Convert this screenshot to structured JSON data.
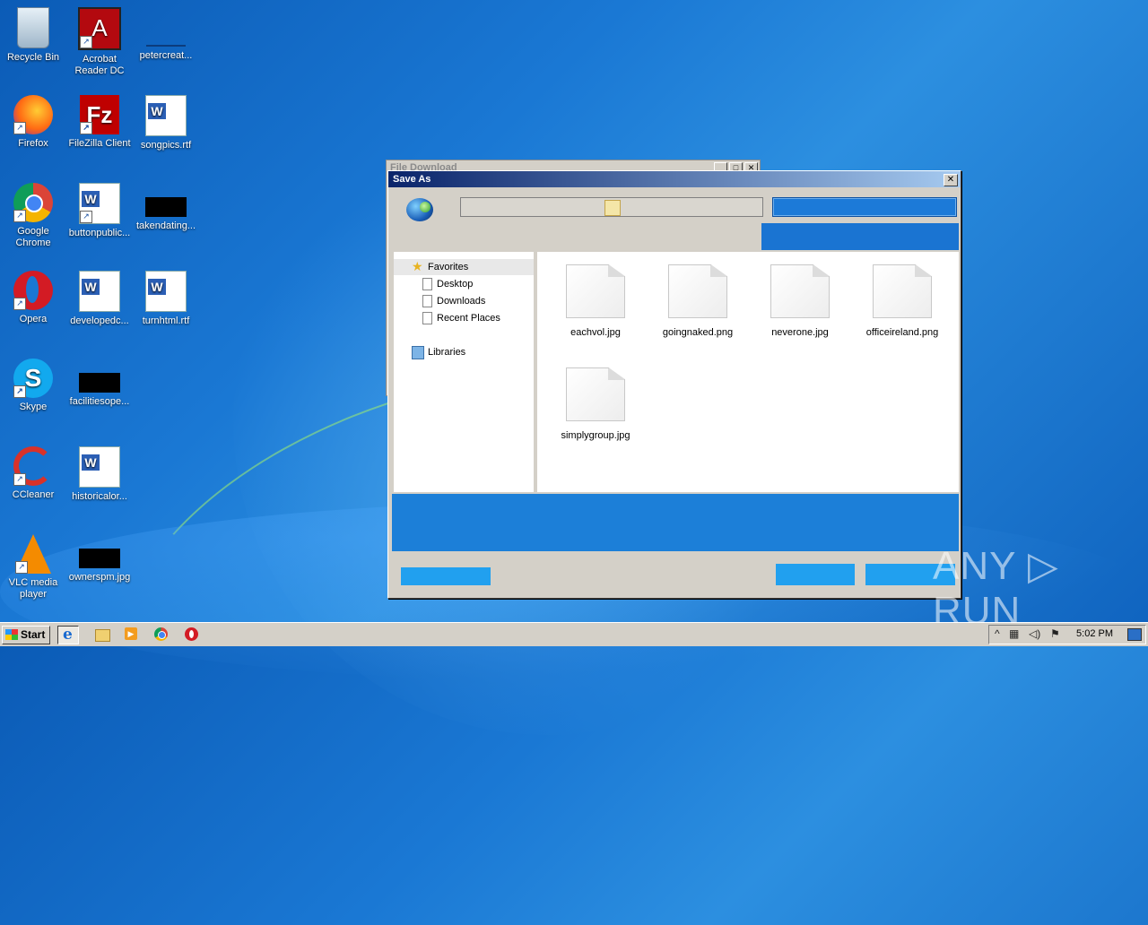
{
  "desktop": {
    "icons": [
      {
        "name": "Recycle Bin"
      },
      {
        "name": "Acrobat Reader DC"
      },
      {
        "name": "petercreat..."
      },
      {
        "name": "Firefox"
      },
      {
        "name": "FileZilla Client"
      },
      {
        "name": "songpics.rtf"
      },
      {
        "name": "Google Chrome"
      },
      {
        "name": "buttonpublic..."
      },
      {
        "name": "takendating..."
      },
      {
        "name": "Opera"
      },
      {
        "name": "developedc..."
      },
      {
        "name": "turnhtml.rtf"
      },
      {
        "name": "Skype"
      },
      {
        "name": "facilitiesope..."
      },
      {
        "name": "CCleaner"
      },
      {
        "name": "historicalor..."
      },
      {
        "name": "VLC media player"
      },
      {
        "name": "ownerspm.jpg"
      }
    ]
  },
  "back_window": {
    "title": "File Download"
  },
  "dialog": {
    "title": "Save As",
    "nav": {
      "favorites": "Favorites",
      "desktop": "Desktop",
      "downloads": "Downloads",
      "recent": "Recent Places",
      "libraries": "Libraries"
    },
    "files": [
      "eachvol.jpg",
      "goingnaked.png",
      "neverone.jpg",
      "officeireland.png",
      "simplygroup.jpg"
    ]
  },
  "taskbar": {
    "start_label": "Start",
    "clock": "5:02 PM"
  },
  "watermark": "ANY ▷ RUN",
  "colors": {
    "titlebar_start": "#0a246a",
    "titlebar_end": "#a6caf0",
    "desktop": "#1a78d4"
  }
}
